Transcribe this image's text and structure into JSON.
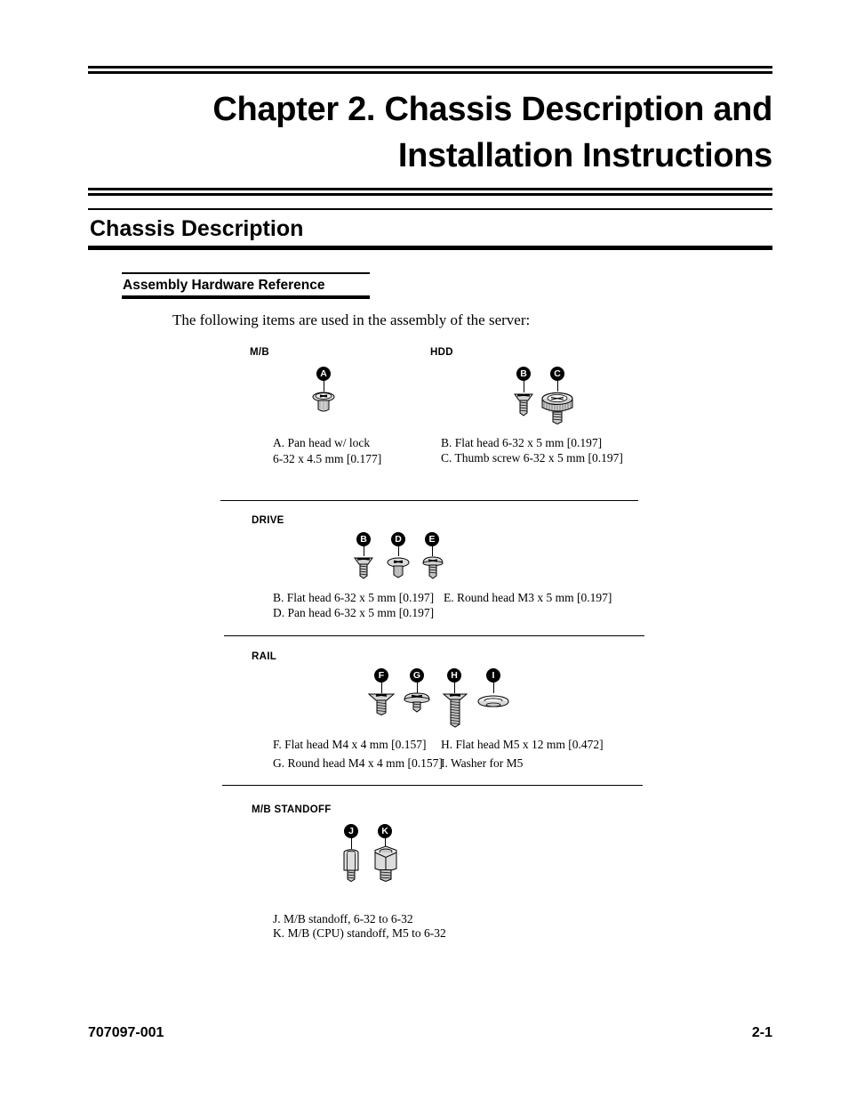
{
  "document": {
    "chapter_title": "Chapter 2.  Chassis Description and\nInstallation Instructions",
    "section_heading": "Chassis Description",
    "subsection_heading": "Assembly Hardware Reference",
    "intro_text": "The following items are used in the assembly of the server:",
    "footer_part_number": "707097-001",
    "footer_page_number": "2-1"
  },
  "groups": [
    {
      "id": "mb",
      "label": "M/B",
      "callouts": [
        "A"
      ],
      "captions": [
        {
          "letter": "A.",
          "text": "Pan head w/ lock\n6-32 x 4.5 mm [0.177]"
        }
      ]
    },
    {
      "id": "hdd",
      "label": "HDD",
      "callouts": [
        "B",
        "C"
      ],
      "captions": [
        {
          "letter": "B.",
          "text": "Flat head 6-32 x 5 mm [0.197]"
        },
        {
          "letter": "C.",
          "text": "Thumb screw 6-32 x 5 mm [0.197]"
        }
      ]
    },
    {
      "id": "drive",
      "label": "DRIVE",
      "callouts": [
        "B",
        "D",
        "E"
      ],
      "captions_left": [
        {
          "letter": "B.",
          "text": "Flat head 6-32 x 5 mm [0.197]"
        },
        {
          "letter": "D.",
          "text": "Pan head 6-32 x 5 mm [0.197]"
        }
      ],
      "captions_right": [
        {
          "letter": "E.",
          "text": "Round head M3 x 5 mm [0.197]"
        }
      ]
    },
    {
      "id": "rail",
      "label": "RAIL",
      "callouts": [
        "F",
        "G",
        "H",
        "I"
      ],
      "captions_left": [
        {
          "letter": "F.",
          "text": "Flat head M4 x 4 mm [0.157]"
        },
        {
          "letter": "G.",
          "text": "Round head M4 x 4 mm [0.157]"
        }
      ],
      "captions_right": [
        {
          "letter": "H.",
          "text": "Flat head M5 x 12 mm [0.472]"
        },
        {
          "letter": "I.",
          "text": "Washer for M5"
        }
      ]
    },
    {
      "id": "mb-standoff",
      "label": "M/B  STANDOFF",
      "callouts": [
        "J",
        "K"
      ],
      "captions": [
        {
          "letter": "J.",
          "text": "M/B standoff, 6-32 to 6-32"
        },
        {
          "letter": "K.",
          "text": "M/B (CPU) standoff, M5 to 6-32"
        }
      ]
    }
  ],
  "callout_letters": {
    "a": "A",
    "b": "B",
    "c": "C",
    "d": "D",
    "e": "E",
    "f": "F",
    "g": "G",
    "h": "H",
    "i": "I",
    "j": "J",
    "k": "K",
    "b2": "B"
  },
  "captions_text": {
    "mb_a": "A.  Pan head w/ lock\n      6-32 x 4.5 mm [0.177]",
    "hdd_b": "B.  Flat head 6-32 x 5 mm [0.197]",
    "hdd_c": "C.  Thumb screw 6-32 x 5 mm [0.197]",
    "drive_b": "B.  Flat head 6-32 x 5 mm [0.197]",
    "drive_d": "D.  Pan head 6-32 x 5 mm [0.197]",
    "drive_e": "E.   Round head M3 x 5 mm [0.197]",
    "rail_f": "F.  Flat head M4 x 4 mm [0.157]",
    "rail_g": "G.  Round head M4 x 4 mm [0.157]",
    "rail_h": "H.  Flat head M5 x 12 mm [0.472]",
    "rail_i": "I.   Washer for M5",
    "standoff_j": "J.   M/B standoff, 6-32 to 6-32",
    "standoff_k": "K.  M/B (CPU) standoff, M5 to 6-32"
  },
  "colors": {
    "ink": "#000000",
    "paper": "#ffffff",
    "metal_light": "#e8e8e8",
    "metal_mid": "#b8b8b8",
    "metal_dark": "#8a8a8a"
  }
}
